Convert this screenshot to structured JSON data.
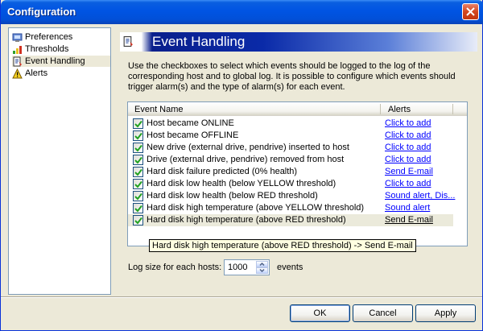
{
  "window": {
    "title": "Configuration"
  },
  "tree": {
    "items": [
      {
        "label": "Preferences",
        "icon": "preferences-icon"
      },
      {
        "label": "Thresholds",
        "icon": "thresholds-icon"
      },
      {
        "label": "Event Handling",
        "icon": "event-handling-icon",
        "selected": true
      },
      {
        "label": "Alerts",
        "icon": "warning-icon"
      }
    ]
  },
  "section": {
    "title": "Event Handling",
    "description": "Use the checkboxes to select which events should be logged to the log of the corresponding host and to global log. It is possible to configure which events should trigger alarm(s) and the type of alarm(s) for each event."
  },
  "events": {
    "columns": [
      "Event Name",
      "Alerts"
    ],
    "rows": [
      {
        "name": "Host became ONLINE",
        "alert": "Click to add",
        "checked": true
      },
      {
        "name": "Host became OFFLINE",
        "alert": "Click to add",
        "checked": true
      },
      {
        "name": "New drive (external drive, pendrive) inserted to host",
        "alert": "Click to add",
        "checked": true
      },
      {
        "name": "Drive (external drive, pendrive) removed from host",
        "alert": "Click to add",
        "checked": true
      },
      {
        "name": "Hard disk failure predicted (0% health)",
        "alert": "Send E-mail",
        "checked": true
      },
      {
        "name": "Hard disk low health (below YELLOW threshold)",
        "alert": "Click to add",
        "checked": true
      },
      {
        "name": "Hard disk low health (below RED threshold)",
        "alert": "Sound alert, Dis...",
        "checked": true
      },
      {
        "name": "Hard disk high temperature (above YELLOW threshold)",
        "alert": "Sound alert",
        "checked": true
      },
      {
        "name": "Hard disk high temperature (above RED threshold)",
        "alert": "Send E-mail",
        "checked": true,
        "highlighted": true
      }
    ],
    "tooltip": "Hard disk high temperature (above RED threshold) -> Send E-mail"
  },
  "log": {
    "label": "Log size for each hosts:",
    "value": "1000",
    "unit": "events"
  },
  "buttons": {
    "ok": "OK",
    "cancel": "Cancel",
    "apply": "Apply"
  },
  "colors": {
    "titlebar": "#0054e3",
    "header_band": "#0a2aa8",
    "link": "#0000ff",
    "checkbox_check": "#21a121"
  }
}
